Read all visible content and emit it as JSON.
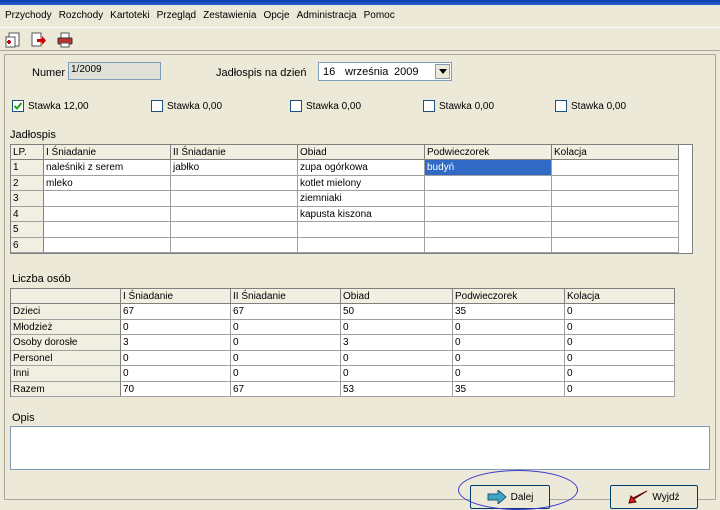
{
  "menu": [
    "Przychody",
    "Rozchody",
    "Kartoteki",
    "Przegląd",
    "Zestawienia",
    "Opcje",
    "Administracja",
    "Pomoc"
  ],
  "toolbar": {
    "icons": [
      "new-document-icon",
      "export-document-icon",
      "print-icon"
    ]
  },
  "form": {
    "numer_label": "Numer",
    "numer_value": "1/2009",
    "jadlospis_na_dzien_label": "Jadłospis na dzień",
    "date_day": "16",
    "date_month": "września",
    "date_year": "2009"
  },
  "stawki": [
    {
      "label": "Stawka 12,00",
      "checked": true
    },
    {
      "label": "Stawka 0,00",
      "checked": false
    },
    {
      "label": "Stawka 0,00",
      "checked": false
    },
    {
      "label": "Stawka 0,00",
      "checked": false
    },
    {
      "label": "Stawka 0,00",
      "checked": false
    }
  ],
  "jadlospis": {
    "section_label": "Jadłospis",
    "headers": [
      "LP.",
      "I Śniadanie",
      "II Śniadanie",
      "Obiad",
      "Podwieczorek",
      "Kolacja"
    ],
    "rows": [
      [
        "1",
        "naleśniki z serem",
        "jabłko",
        "zupa ogórkowa",
        "budyń",
        ""
      ],
      [
        "2",
        "mleko",
        "",
        "kotlet mielony",
        "",
        ""
      ],
      [
        "3",
        "",
        "",
        "ziemniaki",
        "",
        ""
      ],
      [
        "4",
        "",
        "",
        "kapusta kiszona",
        "",
        ""
      ],
      [
        "5",
        "",
        "",
        "",
        "",
        ""
      ],
      [
        "6",
        "",
        "",
        "",
        "",
        ""
      ]
    ]
  },
  "liczba_osob": {
    "section_label": "Liczba osób",
    "headers": [
      "",
      "I Śniadanie",
      "II Śniadanie",
      "Obiad",
      "Podwieczorek",
      "Kolacja"
    ],
    "rows": [
      [
        "Dzieci",
        "67",
        "67",
        "50",
        "35",
        "0"
      ],
      [
        "Młodzież",
        "0",
        "0",
        "0",
        "0",
        "0"
      ],
      [
        "Osoby dorosłe",
        "3",
        "0",
        "3",
        "0",
        "0"
      ],
      [
        "Personel",
        "0",
        "0",
        "0",
        "0",
        "0"
      ],
      [
        "Inni",
        "0",
        "0",
        "0",
        "0",
        "0"
      ],
      [
        "Razem",
        "70",
        "67",
        "53",
        "35",
        "0"
      ]
    ]
  },
  "opis": {
    "label": "Opis",
    "value": ""
  },
  "buttons": {
    "dalej": "Dalej",
    "wyjdz": "Wyjdź"
  }
}
